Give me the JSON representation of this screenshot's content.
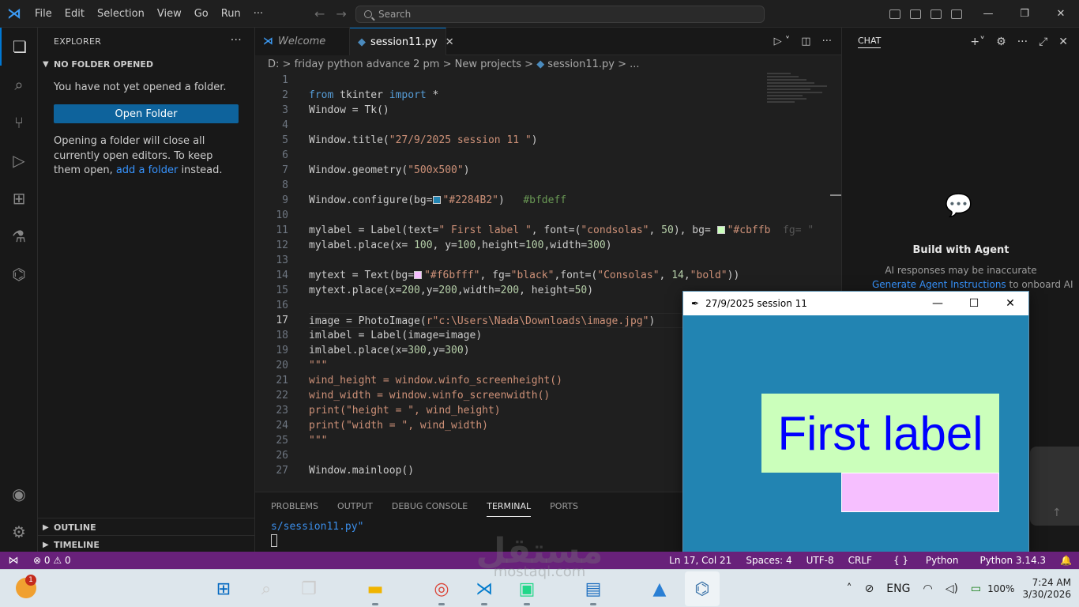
{
  "titlebar": {
    "menu": [
      "File",
      "Edit",
      "Selection",
      "View",
      "Go",
      "Run",
      "···"
    ],
    "search_placeholder": "Search",
    "copilot_icon": "copilot-icon"
  },
  "activity_icons": [
    "explorer-icon",
    "search-icon",
    "source-control-icon",
    "run-debug-icon",
    "extensions-icon",
    "testing-icon",
    "python-icon",
    "accounts-icon",
    "manage-gear-icon"
  ],
  "sidebar": {
    "header": "EXPLORER",
    "section": "NO FOLDER OPENED",
    "message": "You have not yet opened a folder.",
    "open_folder_button": "Open Folder",
    "info_part1": "Opening a folder will close all currently open editors. To keep them open, ",
    "info_link1": "add a",
    "info_link2": "folder",
    "info_part2": " instead.",
    "outline": "OUTLINE",
    "timeline": "TIMELINE"
  },
  "tabs": [
    {
      "label": "Welcome",
      "active": false
    },
    {
      "label": "session11.py",
      "active": true
    }
  ],
  "breadcrumb": {
    "drive": "D:",
    "folder1": "friday python advance 2 pm",
    "folder2": "New projects",
    "file": "session11.py",
    "ellipsis": "..."
  },
  "editor": {
    "current_line": 17,
    "line_count": 27
  },
  "code": {
    "l2": [
      "from",
      " tkinter ",
      "import",
      " *"
    ],
    "l3": "Window = Tk()",
    "l5": [
      "Window.title(",
      "\"27/9/2025 session 11 \"",
      ")"
    ],
    "l7": [
      "Window.geometry(",
      "\"500x500\"",
      ")"
    ],
    "l9": [
      "Window.configure(bg=",
      "\"#2284B2\"",
      ")   ",
      "#bfdeff"
    ],
    "l11": [
      "mylabel = Label(text=",
      "\" First label \"",
      ", font=(",
      "\"condsolas\"",
      ", ",
      "50",
      "), bg= ",
      "\"#cbffb",
      "  fg= \"bl"
    ],
    "l12": [
      "mylabel.place(x= ",
      "100",
      ", y=",
      "100",
      ",height=",
      "100",
      ",width=",
      "300",
      ")"
    ],
    "l14": [
      "mytext = Text(bg=",
      "\"#f6bfff\"",
      ", fg=",
      "\"black\"",
      ",font=(",
      "\"Consolas\"",
      ", ",
      "14",
      ",",
      "\"bold\"",
      "))"
    ],
    "l15": [
      "mytext.place(x=",
      "200",
      ",y=",
      "200",
      ",width=",
      "200",
      ", height=",
      "50",
      ")"
    ],
    "l17": [
      "image = PhotoImage(",
      "r\"c:\\Users\\Nada\\Downloads\\image.jpg\"",
      ")"
    ],
    "l18": "imlabel = Label(image=image)",
    "l19": [
      "imlabel.place(x=",
      "300",
      ",y=",
      "300",
      ")"
    ],
    "l20": "\"\"\"",
    "l21": "wind_height = window.winfo_screenheight()",
    "l22": "wind_width = window.winfo_screenwidth()",
    "l23": "print(\"height = \", wind_height)",
    "l24": "print(\"width = \", wind_width)",
    "l25": "\"\"\"",
    "l27": "Window.mainloop()"
  },
  "panel": {
    "tabs": [
      "PROBLEMS",
      "OUTPUT",
      "DEBUG CONSOLE",
      "TERMINAL",
      "PORTS"
    ],
    "active_tab": "TERMINAL",
    "terminal_line": "s/session11.py\""
  },
  "chat": {
    "header": "CHAT",
    "title": "Build with Agent",
    "subtitle": "AI responses may be inaccurate",
    "link": "Generate Agent Instructions",
    "link_suffix": " to onboard AI"
  },
  "statusbar": {
    "errors": "0",
    "warnings": "0",
    "position": "Ln 17, Col 21",
    "spaces": "Spaces: 4",
    "encoding": "UTF-8",
    "eol": "CRLF",
    "language": "Python",
    "interpreter": "Python 3.14.3"
  },
  "tk_window": {
    "title": "27/9/2025 session 11",
    "label_text": "First label",
    "bg_color": "#2284b2",
    "label_bg": "#cbffbb",
    "label_fg": "#0000ff",
    "text_bg": "#f6bfff"
  },
  "taskbar": {
    "weather_badge": "1",
    "apps": [
      "windows-start-icon",
      "search-icon",
      "task-view-icon",
      "file-explorer-icon",
      "chrome-icon",
      "vscode-icon",
      "pycharm-icon",
      "notepad-icon",
      "photos-icon",
      "python-idle-icon"
    ],
    "language": "ENG",
    "battery": "100%",
    "time": "7:24 AM",
    "date": "3/30/2026"
  },
  "watermark": {
    "arabic": "مستقل",
    "latin": "mostaql.com"
  },
  "colors": {
    "accent": "#0078d4",
    "statusbar": "#68217a",
    "button": "#0e639c"
  }
}
